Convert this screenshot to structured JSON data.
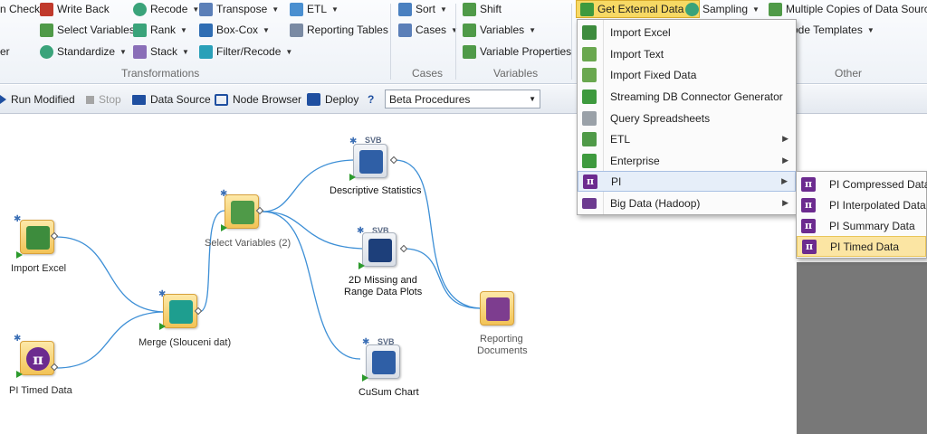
{
  "ribbon": {
    "transformations": {
      "label": "Transformations",
      "row1": [
        "n Check",
        "Write Back",
        "Recode",
        "Transpose",
        "ETL"
      ],
      "row2": [
        "Select Variables",
        "Rank",
        "Box-Cox",
        "Reporting Tables"
      ],
      "row3": [
        "er",
        "Standardize",
        "Stack",
        "Filter/Recode"
      ]
    },
    "cases": {
      "label": "Cases",
      "sort": "Sort",
      "cases": "Cases"
    },
    "variables": {
      "label": "Variables",
      "shift": "Shift",
      "variables": "Variables",
      "properties": "Variable Properties"
    },
    "other": {
      "label": "Other",
      "get_external": "Get External Data",
      "sampling": "Sampling",
      "multiple_copies": "Multiple Copies of Data Source",
      "node_templates": "ode Templates"
    }
  },
  "toolbar": {
    "run_modified": "Run Modified",
    "stop": "Stop",
    "data_source": "Data Source",
    "node_browser": "Node Browser",
    "deploy": "Deploy",
    "help": "?",
    "select_value": "Beta Procedures"
  },
  "nodes": {
    "import_excel": "Import Excel",
    "pi_timed": "PI Timed Data",
    "merge": "Merge (Slouceni dat)",
    "select_vars": "Select Variables (2)",
    "descriptive": "Descriptive Statistics",
    "missing_line1": "2D Missing and",
    "missing_line2": "Range Data Plots",
    "cusum": "CuSum Chart",
    "reporting_line1": "Reporting",
    "reporting_line2": "Documents",
    "svb": "SVB"
  },
  "menu_main": [
    {
      "label": "Import Excel",
      "icon": "xls-icon"
    },
    {
      "label": "Import Text",
      "icon": "text-import-icon"
    },
    {
      "label": "Import Fixed Data",
      "icon": "fixed-data-icon"
    },
    {
      "label": "Streaming DB Connector Generator",
      "icon": "db-connector-icon"
    },
    {
      "label": "Query Spreadsheets",
      "icon": "query-icon"
    },
    {
      "label": "ETL",
      "icon": "etl-icon",
      "submenu": true
    },
    {
      "label": "Enterprise",
      "icon": "enterprise-icon",
      "submenu": true
    },
    {
      "label": "PI",
      "icon": "pi-icon",
      "submenu": true
    },
    {
      "label": "Big Data (Hadoop)",
      "icon": "folder-icon",
      "submenu": true
    }
  ],
  "menu_pi": [
    {
      "label": "PI Compressed Data"
    },
    {
      "label": "PI Interpolated Data"
    },
    {
      "label": "PI Summary Data"
    },
    {
      "label": "PI Timed Data"
    }
  ],
  "colors": {
    "accent_gold": "#f7d964",
    "pi_purple": "#6c2b8f",
    "wire_blue": "#3d8fd6"
  }
}
